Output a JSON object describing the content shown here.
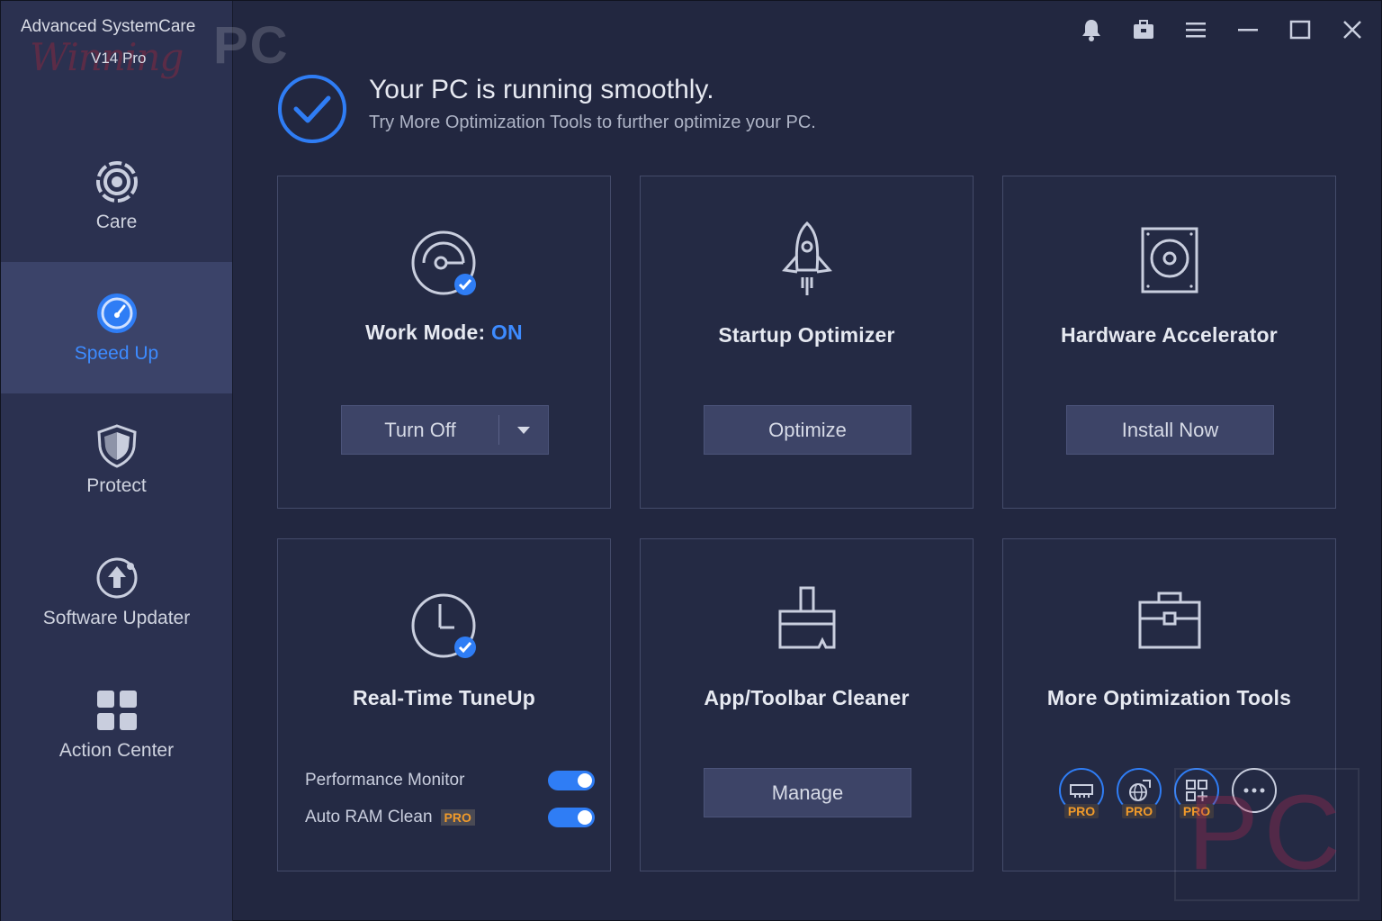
{
  "app": {
    "title": "Advanced SystemCare",
    "version": "V14 Pro",
    "watermark_script": "Winning",
    "watermark_pc": "PC"
  },
  "sidebar": {
    "items": [
      {
        "label": "Care",
        "icon": "care-icon",
        "active": false
      },
      {
        "label": "Speed Up",
        "icon": "speedometer-icon",
        "active": true
      },
      {
        "label": "Protect",
        "icon": "shield-icon",
        "active": false
      },
      {
        "label": "Software Updater",
        "icon": "upload-update-icon",
        "active": false
      },
      {
        "label": "Action Center",
        "icon": "grid-icon",
        "active": false
      }
    ]
  },
  "titlebar": {
    "icons": [
      "bell-icon",
      "toolbox-icon",
      "menu-icon",
      "minimize-icon",
      "maximize-icon",
      "close-icon"
    ]
  },
  "status": {
    "title": "Your PC is running smoothly.",
    "subtitle": "Try More Optimization Tools to further optimize your PC."
  },
  "cards": {
    "work_mode": {
      "title": "Work Mode:",
      "state": "ON",
      "button": "Turn Off"
    },
    "startup": {
      "title": "Startup Optimizer",
      "button": "Optimize"
    },
    "hardware": {
      "title": "Hardware Accelerator",
      "button": "Install Now"
    },
    "realtime": {
      "title": "Real-Time TuneUp",
      "toggles": [
        {
          "label": "Performance Monitor",
          "on": true,
          "pro": ""
        },
        {
          "label": "Auto RAM Clean",
          "on": true,
          "pro": "PRO"
        }
      ]
    },
    "app_cleaner": {
      "title": "App/Toolbar Cleaner",
      "button": "Manage"
    },
    "more_tools": {
      "title": "More Optimization Tools",
      "tools": [
        {
          "icon": "ram-icon",
          "badge": "PRO"
        },
        {
          "icon": "internet-booster-icon",
          "badge": "PRO"
        },
        {
          "icon": "apps-icon",
          "badge": "PRO"
        },
        {
          "icon": "more-icon",
          "badge": ""
        }
      ]
    }
  },
  "colors": {
    "accent": "#3d8bff",
    "pro": "#f09a2a",
    "background": "#222740",
    "sidebar": "#2b3150"
  }
}
